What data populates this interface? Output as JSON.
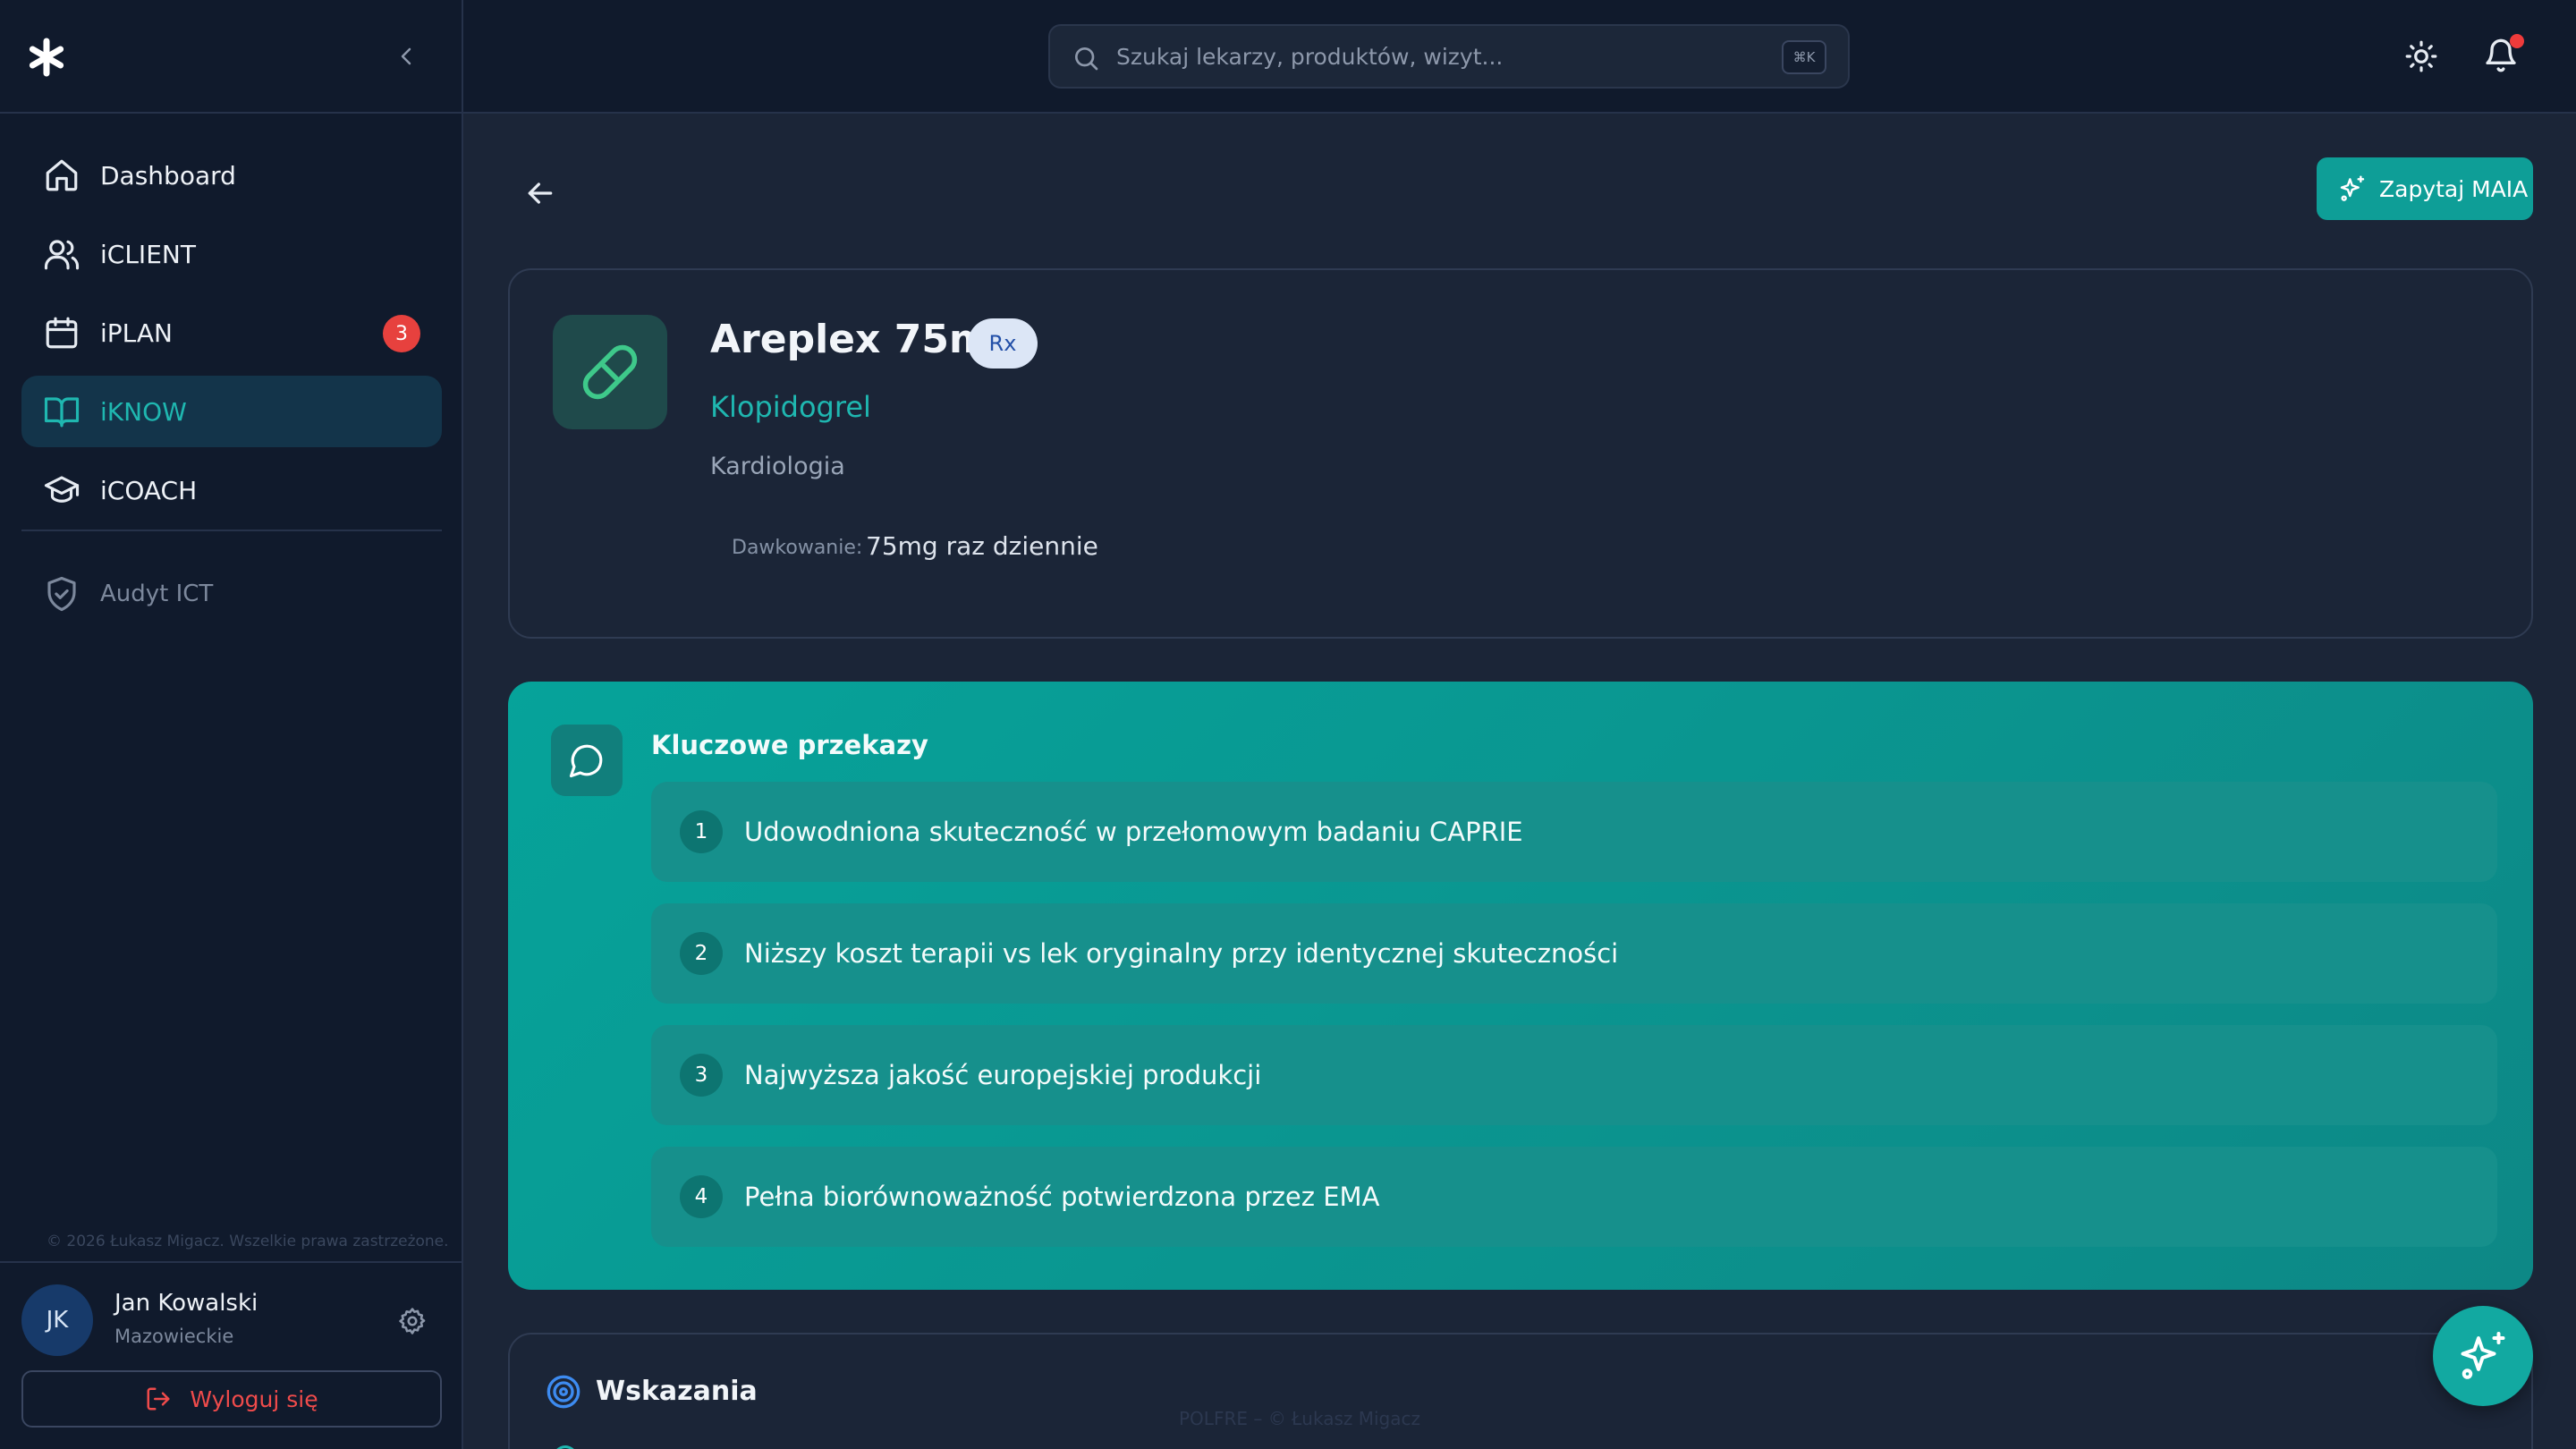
{
  "sidebar": {
    "nav": [
      {
        "label": "Dashboard",
        "icon": "home-icon"
      },
      {
        "label": "iCLIENT",
        "icon": "users-icon"
      },
      {
        "label": "iPLAN",
        "icon": "calendar-icon",
        "badge": "3"
      },
      {
        "label": "iKNOW",
        "icon": "book-open-icon",
        "active": true
      },
      {
        "label": "iCOACH",
        "icon": "graduation-cap-icon"
      }
    ],
    "audit_label": "Audyt ICT",
    "copyright": "© 2026 Łukasz Migacz. Wszelkie prawa zastrzeżone.",
    "user": {
      "initials": "JK",
      "name": "Jan Kowalski",
      "region": "Mazowieckie"
    },
    "logout_label": "Wyloguj się"
  },
  "topbar": {
    "search_placeholder": "Szukaj lekarzy, produktów, wizyt...",
    "search_shortcut": "⌘K"
  },
  "main": {
    "ask_button": "Zapytaj MAIA",
    "product": {
      "name": "Areplex 75mg",
      "badge": "Rx",
      "substance": "Klopidogrel",
      "area": "Kardiologia",
      "dose_label": "Dawkowanie:",
      "dose_value": "75mg raz dziennie"
    },
    "key_messages": {
      "title": "Kluczowe przekazy",
      "items": [
        {
          "num": "1",
          "text": "Udowodniona skuteczność w przełomowym badaniu CAPRIE"
        },
        {
          "num": "2",
          "text": "Niższy koszt terapii vs lek oryginalny przy identycznej skuteczności"
        },
        {
          "num": "3",
          "text": "Najwyższa jakość europejskiej produkcji"
        },
        {
          "num": "4",
          "text": "Pełna biorównoważność potwierdzona przez EMA"
        }
      ]
    },
    "indications_title": "Wskazania",
    "footer_mark": "POLFRE – © Łukasz Migacz"
  },
  "colors": {
    "accent": "#0e9e97",
    "sidebar_bg": "#101a2c",
    "main_bg": "#1b2537",
    "danger": "#ef4b4b"
  }
}
